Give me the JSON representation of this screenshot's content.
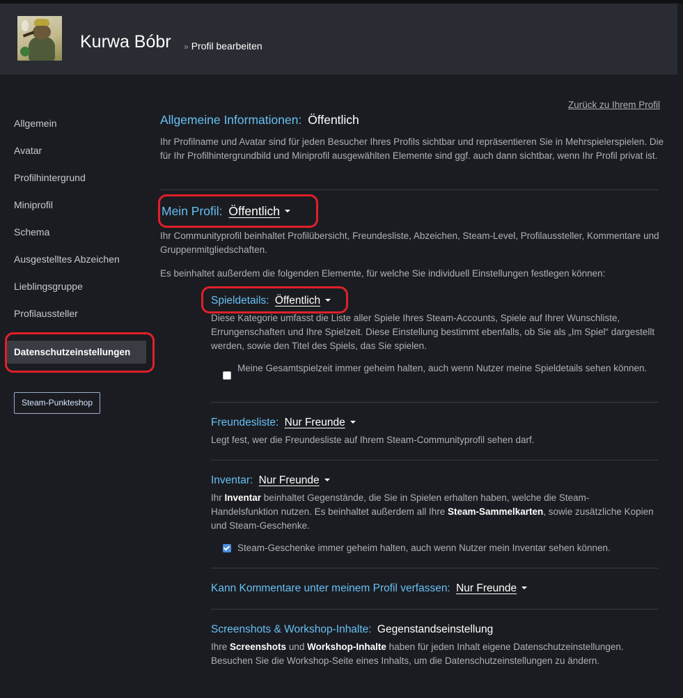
{
  "header": {
    "username": "Kurwa Bóbr",
    "separator": "»",
    "breadcrumb": "Profil bearbeiten"
  },
  "sidebar": {
    "items": [
      {
        "label": "Allgemein"
      },
      {
        "label": "Avatar"
      },
      {
        "label": "Profilhintergrund"
      },
      {
        "label": "Miniprofil"
      },
      {
        "label": "Schema"
      },
      {
        "label": "Ausgestelltes Abzeichen"
      },
      {
        "label": "Lieblingsgruppe"
      },
      {
        "label": "Profilaussteller"
      },
      {
        "label": "Datenschutzeinstellungen",
        "active": true
      }
    ],
    "shop_button": "Steam-Punkteshop"
  },
  "back_link": "Zurück zu Ihrem Profil",
  "general": {
    "title": "Allgemeine Informationen:",
    "value": "Öffentlich",
    "description": "Ihr Profilname und Avatar sind für jeden Besucher Ihres Profils sichtbar und repräsentieren Sie in Mehrspielerspielen. Die für Ihr Profilhintergrundbild und Miniprofil ausgewählten Elemente sind ggf. auch dann sichtbar, wenn Ihr Profil privat ist."
  },
  "my_profile": {
    "title": "Mein Profil:",
    "value": "Öffentlich",
    "description": "Ihr Communityprofil beinhaltet Profilübersicht, Freundesliste, Abzeichen, Steam-Level, Profilaussteller, Kommentare und Gruppenmitgliedschaften.",
    "elements_intro": "Es beinhaltet außerdem die folgenden Elemente, für welche Sie individuell Einstellungen festlegen können:"
  },
  "game_details": {
    "title": "Spieldetails:",
    "value": "Öffentlich",
    "description": "Diese Kategorie umfasst die Liste aller Spiele Ihres Steam-Accounts, Spiele auf Ihrer Wunschliste, Errungenschaften und Ihre Spielzeit. Diese Einstellung bestimmt ebenfalls, ob Sie als „Im Spiel“ dargestellt werden, sowie den Titel des Spiels, das Sie spielen.",
    "checkbox_label": "Meine Gesamtspielzeit immer geheim halten, auch wenn Nutzer meine Spieldetails sehen können.",
    "checkbox_checked": false
  },
  "friends_list": {
    "title": "Freundesliste:",
    "value": "Nur Freunde",
    "description": "Legt fest, wer die Freundesliste auf Ihrem Steam-Communityprofil sehen darf."
  },
  "inventory": {
    "title": "Inventar:",
    "value": "Nur Freunde",
    "desc_1": "Ihr ",
    "desc_bold_1": "Inventar",
    "desc_2": " beinhaltet Gegenstände, die Sie in Spielen erhalten haben, welche die Steam-Handelsfunktion nutzen. Es beinhaltet außerdem all Ihre ",
    "desc_bold_2": "Steam-Sammelkarten",
    "desc_3": ", sowie zusätzliche Kopien und Steam-Geschenke.",
    "checkbox_label": "Steam-Geschenke immer geheim halten, auch wenn Nutzer mein Inventar sehen können.",
    "checkbox_checked": true
  },
  "comments": {
    "title": "Kann Kommentare unter meinem Profil verfassen:",
    "value": "Nur Freunde"
  },
  "screenshots": {
    "title": "Screenshots & Workshop-Inhalte:",
    "value": "Gegenstandseinstellung",
    "desc_1": "Ihre ",
    "desc_bold_1": "Screenshots",
    "desc_2": " und ",
    "desc_bold_2": "Workshop-Inhalte",
    "desc_3": " haben für jeden Inhalt eigene Datenschutzeinstellungen. Besuchen Sie die Workshop-Seite eines Inhalts, um die Datenschutzeinstellungen zu ändern."
  },
  "colors": {
    "accent_blue": "#66c0f4",
    "annotation_red": "#e0202a",
    "background": "#1b1c21",
    "header_bg": "#2a2c33"
  },
  "icons": [
    "dropdown-caret-icon",
    "checkbox-icon",
    "avatar-image"
  ]
}
